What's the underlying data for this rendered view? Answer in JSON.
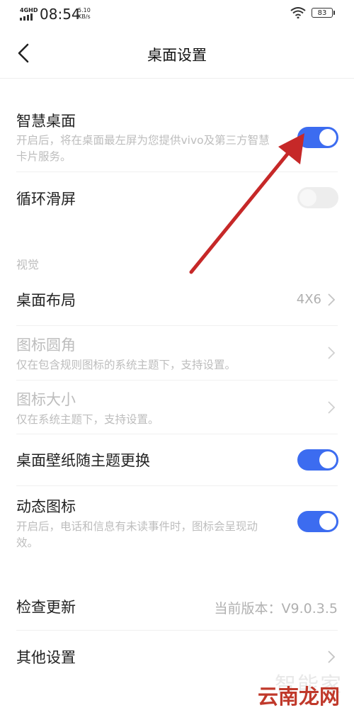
{
  "status_bar": {
    "network": "4GHD",
    "time": "08:54",
    "speed_value": "5.10",
    "speed_unit": "KB/s",
    "battery": "83"
  },
  "header": {
    "title": "桌面设置"
  },
  "items": {
    "smart_desktop": {
      "title": "智慧桌面",
      "subtitle": "开启后，将在桌面最左屏为您提供vivo及第三方智慧卡片服务。",
      "toggle": true
    },
    "loop_scroll": {
      "title": "循环滑屏",
      "toggle": false
    },
    "section_visual": "视觉",
    "desktop_layout": {
      "title": "桌面布局",
      "value": "4X6"
    },
    "icon_corner": {
      "title": "图标圆角",
      "subtitle": "仅在包含规则图标的系统主题下，支持设置。"
    },
    "icon_size": {
      "title": "图标大小",
      "subtitle": "仅在系统主题下，支持设置。"
    },
    "wallpaper_follow_theme": {
      "title": "桌面壁纸随主题更换",
      "toggle": true
    },
    "dynamic_icon": {
      "title": "动态图标",
      "subtitle": "开启后，电话和信息有未读事件时，图标会呈现动效。",
      "toggle": true
    },
    "check_update": {
      "title": "检查更新",
      "value": "当前版本：V9.0.3.5"
    },
    "other_settings": {
      "title": "其他设置"
    }
  },
  "watermark": {
    "line1": "智能家",
    "line2": "云南龙网"
  },
  "colors": {
    "accent": "#3c6cf0",
    "annotation_arrow": "#c62828"
  }
}
